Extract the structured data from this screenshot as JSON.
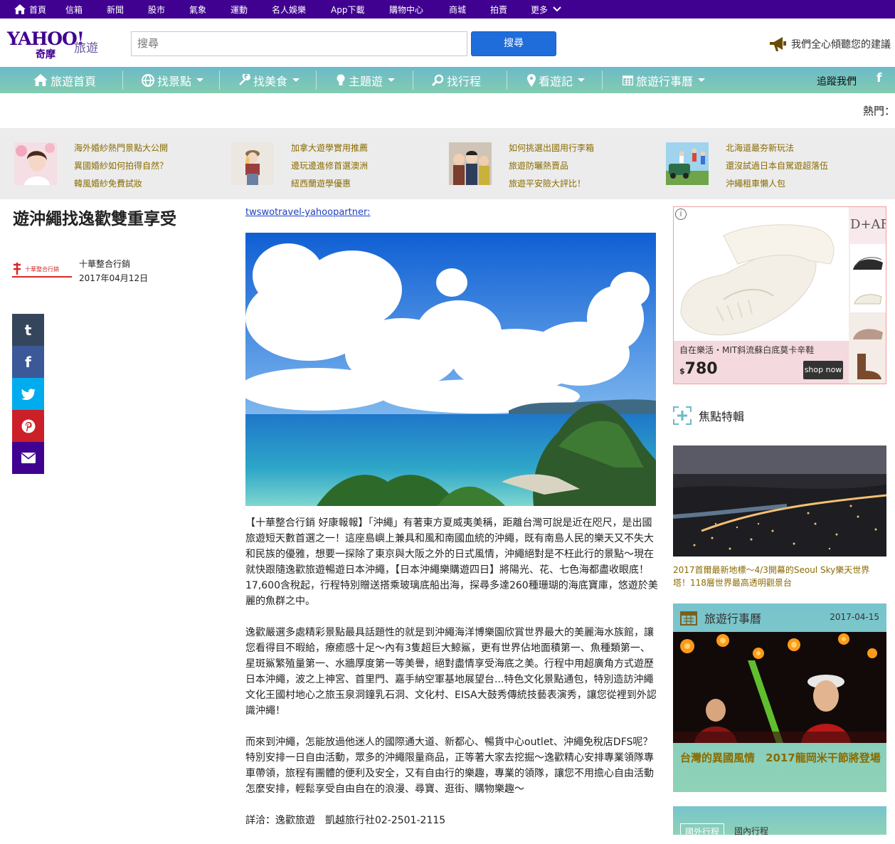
{
  "topbar": {
    "items": [
      "首頁",
      "信箱",
      "新聞",
      "股市",
      "氣象",
      "運動",
      "名人娛樂",
      "App下載",
      "購物中心",
      "商城",
      "拍賣",
      "更多"
    ]
  },
  "header": {
    "logo_yahoo": "YAHOO!",
    "logo_qimo": "奇摩",
    "logo_section": "旅遊",
    "search_placeholder": "搜尋",
    "search_button": "搜尋",
    "feedback": "我們全心傾聽您的建議"
  },
  "nav": {
    "items": [
      "旅遊首頁",
      "找景點",
      "找美食",
      "主題遊",
      "找行程",
      "看遊記",
      "旅遊行事曆"
    ],
    "follow": "追蹤我們",
    "facebook": "f"
  },
  "hot_label": "熱門：",
  "featured": [
    {
      "links": [
        "海外婚紗熱門景點大公開",
        "異國婚紗如何拍得自然？",
        "韓風婚紗免費試妝"
      ]
    },
    {
      "links": [
        "加拿大遊學實用推薦",
        "邊玩邊進修首選澳洲",
        "紐西蘭遊學優惠"
      ]
    },
    {
      "links": [
        "如何挑選出國用行李箱",
        "旅遊防曬熱賣品",
        "旅遊平安險大評比！"
      ]
    },
    {
      "links": [
        "北海道最夯新玩法",
        "還沒試過日本自駕遊超落伍",
        "沖繩租車懶人包"
      ]
    }
  ],
  "article": {
    "title": "遊沖繩找逸歡雙重享受",
    "author": "十華整合行銷",
    "date": "2017年04月12日",
    "author_logo_text": "十華整合行銷",
    "source": "twswotravel-yahoopartner",
    "source_suffix": ":",
    "paragraphs": [
      "【十華整合行銷 好康報報】「沖繩」有著東方夏威夷美稱，距離台灣可說是近在咫尺，是出國旅遊短天數首選之一！這座島嶼上兼具和風和南國血統的沖繩，既有南島人民的樂天又不失大和民族的優雅，想要一探除了東京與大阪之外的日式風情，沖繩絕對是不枉此行的景點～現在就快跟隨逸歡旅遊暢遊日本沖繩，【日本沖繩樂購遊四日】將陽光、花、七色海都盡收眼底！17,600含稅起，行程特別贈送搭乘玻璃底船出海，探尋多達260種珊瑚的海底寶庫，悠遊於美麗的魚群之中。",
      "逸歡嚴選多處精彩景點最具話題性的就是到沖繩海洋博樂園欣賞世界最大的美麗海水族館，讓您看得目不暇給，療癒感十足～內有3隻超巨大鯨鯊，更有世界佔地面積第一、魚種類第一、星斑鯊繁殖量第一、水牆厚度第一等美譽，絕對盡情享受海底之美。行程中用超廣角方式遊歷日本沖繩，波之上神宮、首里門、嘉手納空軍基地展望台...特色文化景點通包，特別造訪沖繩文化王國村地心之旅玉泉洞鐘乳石洞、文化村、EISA大鼓秀傳統技藝表演秀，讓您從裡到外認識沖繩！",
      "而來到沖繩，怎能放過他迷人的國際通大道、新都心、暢貨中心outlet、沖繩免稅店DFS呢？特別安排一日自由活動，眾多的沖繩限量商品，正等著大家去挖掘～逸歡精心安排專業領隊專車帶領，旅程有團體的便利及安全，又有自由行的樂趣，專業的領隊，讓您不用擔心自由活動怎麼安排，輕鬆享受自由自在的浪漫、尋寶、逛街、購物樂趣～",
      "詳洽：逸歡旅遊　凱越旅行社02-2501-2115"
    ]
  },
  "share": {
    "buttons": [
      "t",
      "f",
      "tw",
      "p",
      "mail"
    ]
  },
  "ad": {
    "brand": "D+AF",
    "description": "自在樂活・MIT斜流蘇白底莫卡辛鞋",
    "currency": "$",
    "price": "780",
    "cta": "shop now",
    "info": "i"
  },
  "focus": {
    "heading": "焦點特輯",
    "caption": "2017首爾最新地標～4/3開幕的Seoul Sky樂天世界塔！118層世界最高透明觀景台"
  },
  "calendar": {
    "heading": "旅遊行事曆",
    "date": "2017-04-15",
    "caption": "台灣的異國風情　2017龍岡米干節將登場"
  },
  "tabs": {
    "items": [
      "國外行程",
      "國內行程"
    ]
  },
  "colors": {
    "topbar": "#400090",
    "nav_gradient_top": "#6bbac9",
    "nav_gradient_bottom": "#83ccb0",
    "link_gold": "#8a6b00",
    "search_blue": "#1f6ddb",
    "share_tumblr": "#35465c",
    "share_facebook": "#3b5998",
    "share_twitter": "#00aced",
    "share_pinterest": "#cb2027",
    "share_mail": "#400090"
  }
}
